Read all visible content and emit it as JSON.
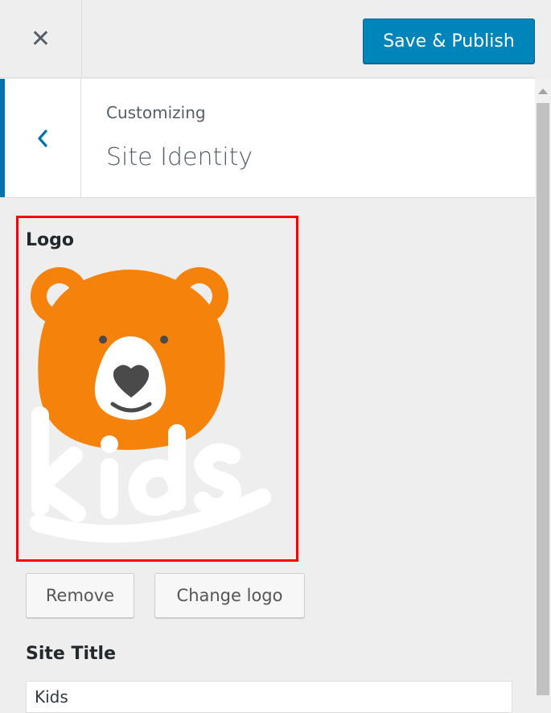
{
  "header": {
    "close_icon": "✕",
    "publish_label": "Save & Publish"
  },
  "section": {
    "back_icon": "‹",
    "breadcrumb": "Customizing",
    "title": "Site Identity"
  },
  "logo": {
    "label": "Logo",
    "image": "bear-kids-logo",
    "remove_label": "Remove",
    "change_label": "Change logo"
  },
  "site_title": {
    "label": "Site Title",
    "value": "Kids"
  },
  "colors": {
    "accent": "#0085ba",
    "logo_orange": "#f5820b",
    "highlight": "#ff0000"
  }
}
